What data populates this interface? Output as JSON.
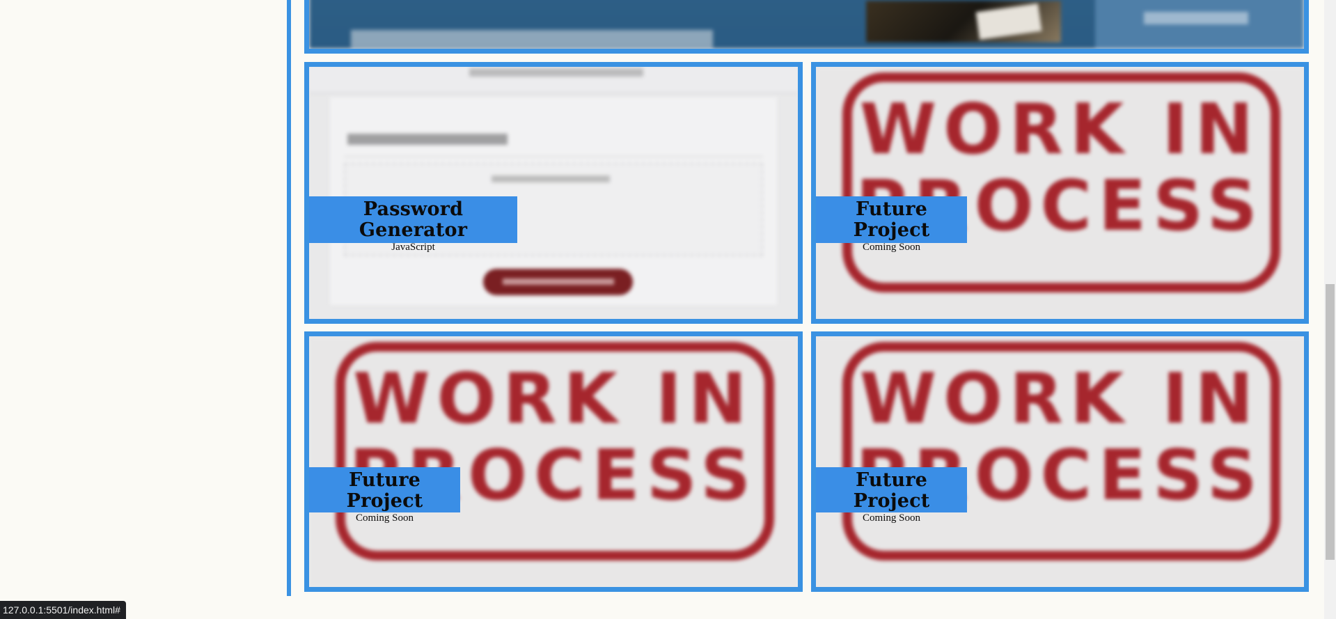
{
  "projects": [
    {
      "title": "Password Generator",
      "subtitle": "JavaScript"
    },
    {
      "title": "Future Project",
      "subtitle": "Coming Soon"
    },
    {
      "title": "Future Project",
      "subtitle": "Coming Soon"
    },
    {
      "title": "Future Project",
      "subtitle": "Coming Soon"
    }
  ],
  "wip_stamp": {
    "line1": "WORK IN",
    "line2": "PROCESS"
  },
  "status_bar": {
    "url": "127.0.0.1:5501/index.html#"
  },
  "colors": {
    "accent_blue": "#3a92e2",
    "stamp_red": "#a6262d",
    "page_bg": "#fbfaf5"
  }
}
